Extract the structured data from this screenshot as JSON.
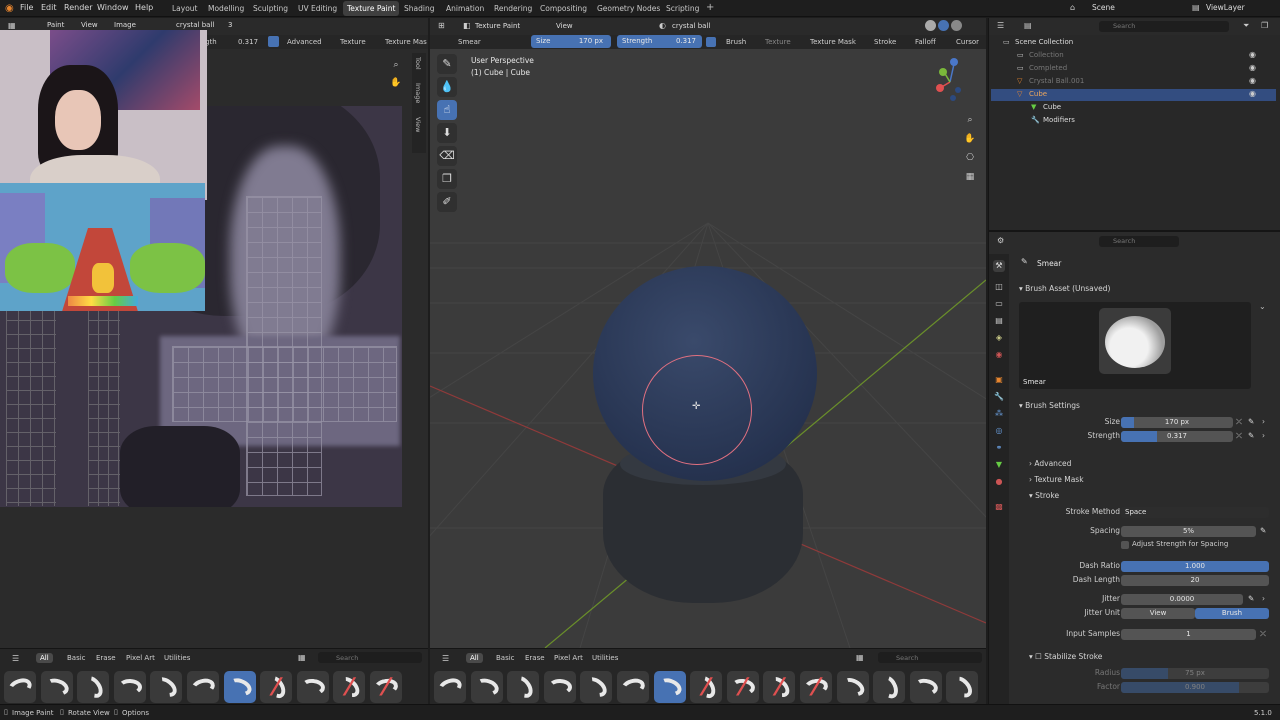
{
  "menu": [
    "File",
    "Edit",
    "Render",
    "Window",
    "Help"
  ],
  "workspaces": [
    "Layout",
    "Modelling",
    "Sculpting",
    "UV Editing",
    "Texture Paint",
    "Shading",
    "Animation",
    "Rendering",
    "Compositing",
    "Geometry Nodes",
    "Scripting"
  ],
  "active_workspace": "Texture Paint",
  "scene": "Scene",
  "view_layer": "ViewLayer",
  "image_editor": {
    "mode": "Paint",
    "view": "View",
    "image": "Image",
    "image_name": "crystal ball",
    "image_users": "3",
    "strength_label": "gth",
    "strength_value": "0.317",
    "advanced": "Advanced",
    "texture": "Texture",
    "texture_mask": "Texture Mas",
    "side_tabs": [
      "Tool",
      "Image",
      "View"
    ]
  },
  "viewport_header": {
    "mode": "Texture Paint",
    "view": "View",
    "brush": "Smear",
    "size_label": "Size",
    "size_value": "170 px",
    "strength_label": "Strength",
    "strength_value": "0.317",
    "menus": [
      "Brush",
      "Texture",
      "Texture Mask",
      "Stroke",
      "Falloff",
      "Cursor"
    ],
    "object": "crystal ball"
  },
  "viewport": {
    "perspective": "User Perspective",
    "object_info": "(1) Cube | Cube"
  },
  "outliner": {
    "search_placeholder": "Search",
    "rows": [
      {
        "label": "Scene Collection",
        "indent": 0,
        "dim": false,
        "selected": false,
        "icon": "collection-icon"
      },
      {
        "label": "Collection",
        "indent": 1,
        "dim": true,
        "selected": false,
        "icon": "collection-icon"
      },
      {
        "label": "Completed",
        "indent": 1,
        "dim": true,
        "selected": false,
        "icon": "collection-icon"
      },
      {
        "label": "Crystal Ball.001",
        "indent": 1,
        "dim": true,
        "selected": false,
        "icon": "mesh-icon"
      },
      {
        "label": "Cube",
        "indent": 1,
        "dim": false,
        "selected": true,
        "icon": "mesh-icon"
      },
      {
        "label": "Cube",
        "indent": 2,
        "dim": false,
        "selected": false,
        "icon": "mesh-data-icon"
      },
      {
        "label": "Modifiers",
        "indent": 2,
        "dim": false,
        "selected": false,
        "icon": "wrench-icon"
      }
    ]
  },
  "properties": {
    "search_placeholder": "Search",
    "brush_name": "Smear",
    "brush_asset": "Brush Asset (Unsaved)",
    "preview_label": "Smear",
    "brush_settings": "Brush Settings",
    "size_label": "Size",
    "size_value": "170 px",
    "size_fill": 0.12,
    "strength_label": "Strength",
    "strength_value": "0.317",
    "strength_fill": 0.32,
    "advanced": "Advanced",
    "texture_mask": "Texture Mask",
    "stroke": "Stroke",
    "stroke_method_label": "Stroke Method",
    "stroke_method_value": "Space",
    "spacing_label": "Spacing",
    "spacing_value": "5%",
    "adjust_strength": "Adjust Strength for Spacing",
    "dash_ratio_label": "Dash Ratio",
    "dash_ratio_value": "1.000",
    "dash_length_label": "Dash Length",
    "dash_length_value": "20",
    "jitter_label": "Jitter",
    "jitter_value": "0.0000",
    "jitter_unit_label": "Jitter Unit",
    "jitter_unit_view": "View",
    "jitter_unit_brush": "Brush",
    "input_samples_label": "Input Samples",
    "input_samples_value": "1",
    "stabilize_stroke": "Stabilize Stroke",
    "radius_label": "Radius",
    "radius_value": "75 px",
    "factor_label": "Factor",
    "factor_value": "0.900"
  },
  "shelf": {
    "tabs": [
      "All",
      "Basic",
      "Erase",
      "Pixel Art",
      "Utilities"
    ],
    "search_placeholder": "Search"
  },
  "status_bar": {
    "items": [
      "Image Paint",
      "Rotate View",
      "Options"
    ],
    "version": "5.1.0"
  },
  "colors": {
    "accent": "#4772b3",
    "panel": "#2b2b2b",
    "viewport_bg": "#3a3a3a",
    "ball": "#2c3a57",
    "brush_circle": "#e07080"
  }
}
